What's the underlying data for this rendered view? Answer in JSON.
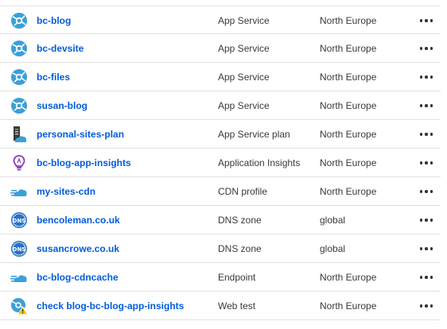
{
  "colors": {
    "link": "#015cda",
    "text": "#3a3a3a",
    "divider": "#e1e1e1",
    "app_service_icon": "#3c9fd8",
    "plan_icon_dark": "#3a3a3a",
    "plan_icon_cloud": "#3c9fd8",
    "insights_icon": "#8a3bb8",
    "cdn_icon": "#3c9fd8",
    "dns_icon": "#2872c6",
    "warning_icon": "#f5c400"
  },
  "resources": [
    {
      "name": "bc-blog",
      "type": "App Service",
      "location": "North Europe",
      "icon": "app-service-icon"
    },
    {
      "name": "bc-devsite",
      "type": "App Service",
      "location": "North Europe",
      "icon": "app-service-icon"
    },
    {
      "name": "bc-files",
      "type": "App Service",
      "location": "North Europe",
      "icon": "app-service-icon"
    },
    {
      "name": "susan-blog",
      "type": "App Service",
      "location": "North Europe",
      "icon": "app-service-icon"
    },
    {
      "name": "personal-sites-plan",
      "type": "App Service plan",
      "location": "North Europe",
      "icon": "app-service-plan-icon"
    },
    {
      "name": "bc-blog-app-insights",
      "type": "Application Insights",
      "location": "North Europe",
      "icon": "lightbulb-icon"
    },
    {
      "name": "my-sites-cdn",
      "type": "CDN profile",
      "location": "North Europe",
      "icon": "cdn-cloud-icon"
    },
    {
      "name": "bencoleman.co.uk",
      "type": "DNS zone",
      "location": "global",
      "icon": "dns-icon"
    },
    {
      "name": "susancrowe.co.uk",
      "type": "DNS zone",
      "location": "global",
      "icon": "dns-icon"
    },
    {
      "name": "bc-blog-cdncache",
      "type": "Endpoint",
      "location": "North Europe",
      "icon": "cdn-cloud-icon"
    },
    {
      "name": "check blog-bc-blog-app-insights",
      "type": "Web test",
      "location": "North Europe",
      "icon": "web-test-icon"
    }
  ]
}
